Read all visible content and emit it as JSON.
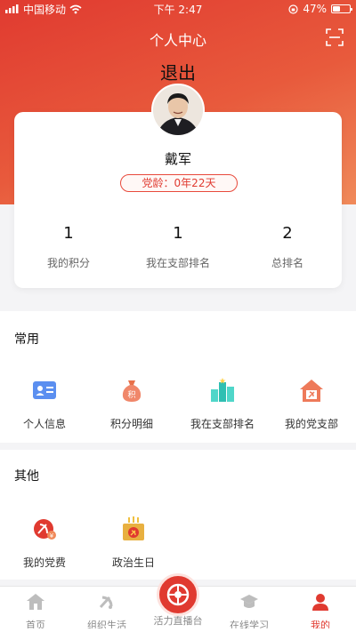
{
  "status_bar": {
    "carrier": "中国移动",
    "time": "下午 2:47",
    "battery": "47%",
    "battery_level": 0.47
  },
  "header": {
    "title": "个人中心",
    "logout_label": "退出"
  },
  "profile": {
    "name": "戴军",
    "party_age": "党龄：0年22天",
    "stats": [
      {
        "value": "1",
        "label": "我的积分"
      },
      {
        "value": "1",
        "label": "我在支部排名"
      },
      {
        "value": "2",
        "label": "总排名"
      }
    ]
  },
  "common": {
    "title": "常用",
    "items": [
      {
        "label": "个人信息",
        "icon": "id-card-icon"
      },
      {
        "label": "积分明细",
        "icon": "money-bag-icon"
      },
      {
        "label": "我在支部排名",
        "icon": "ranking-icon"
      },
      {
        "label": "我的党支部",
        "icon": "party-house-icon"
      }
    ]
  },
  "other": {
    "title": "其他",
    "items": [
      {
        "label": "我的党费",
        "icon": "party-fee-icon"
      },
      {
        "label": "政治生日",
        "icon": "birthday-cake-icon"
      }
    ]
  },
  "tabbar": {
    "items": [
      {
        "label": "首页",
        "icon": "home-icon"
      },
      {
        "label": "组织生活",
        "icon": "party-emblem-icon"
      },
      {
        "label": "活力直播台",
        "icon": "live-icon"
      },
      {
        "label": "在线学习",
        "icon": "graduation-cap-icon"
      },
      {
        "label": "我的",
        "icon": "user-icon"
      }
    ]
  },
  "colors": {
    "accent": "#e03a30",
    "hero_end": "#f08a5a",
    "gold": "#e8b040"
  }
}
